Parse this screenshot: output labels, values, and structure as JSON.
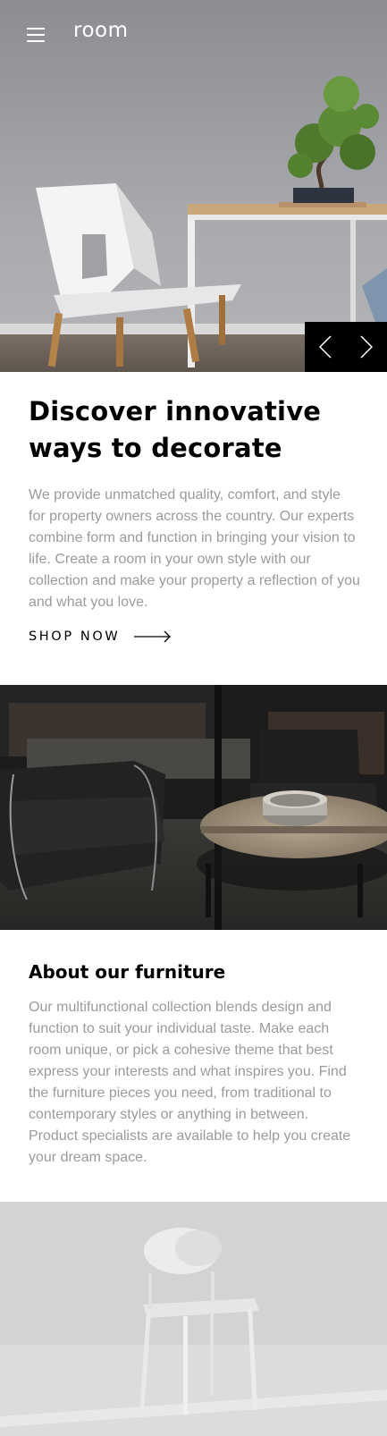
{
  "header": {
    "logo": "room",
    "menu_icon": "hamburger-menu-icon"
  },
  "hero": {
    "image_alt": "White chair and table with bonsai",
    "prev_icon": "chevron-left-icon",
    "next_icon": "chevron-right-icon"
  },
  "intro": {
    "title_line1": "Discover innovative",
    "title_line2": "ways to decorate",
    "body": "We provide unmatched quality, comfort, and style for property owners across the country. Our experts combine form and function in bringing your vision to life. Create a room in your own style with our collection and make your property a reflection of you and what you love.",
    "cta_label": "SHOP NOW",
    "cta_icon": "arrow-right-icon"
  },
  "about": {
    "title": "About our furniture",
    "body": "Our multifunctional collection blends design and function to suit your individual taste. Make each room unique, or pick a cohesive theme that best express your interests and what inspires you. Find the furniture pieces you need, from traditional to contemporary styles or anything in between. Product specialists are available to help you create your dream space."
  },
  "colors": {
    "text_primary": "#000000",
    "text_muted": "#9b9b9b",
    "nav_background": "#000000"
  }
}
